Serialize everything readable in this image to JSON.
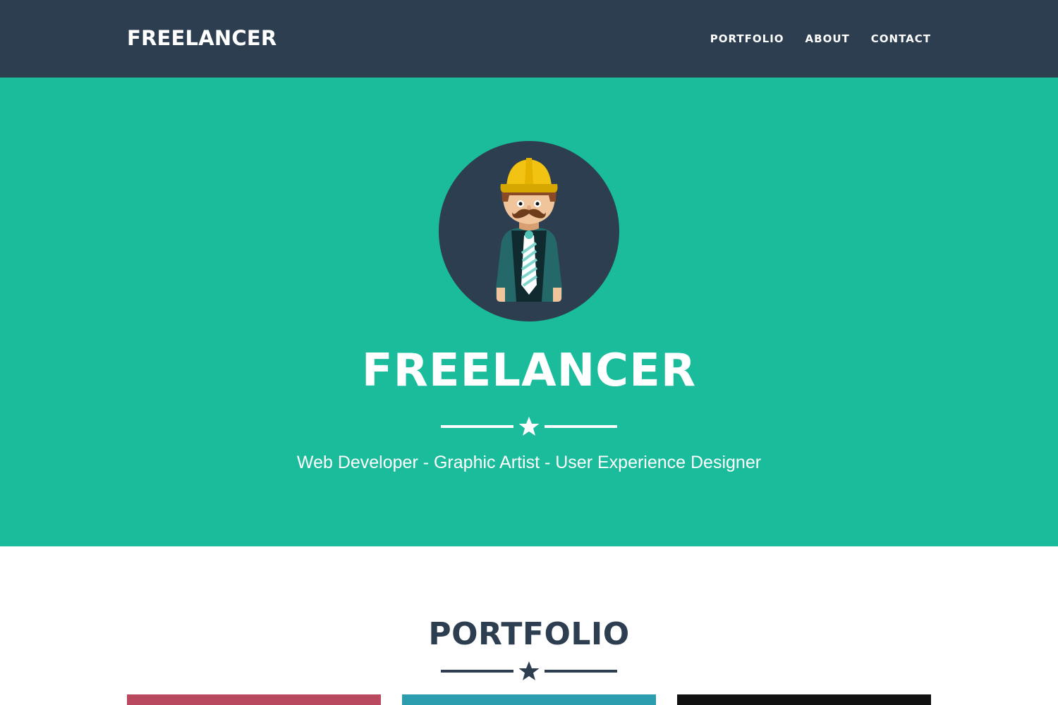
{
  "navbar": {
    "brand": "FREELANCER",
    "links": [
      "PORTFOLIO",
      "ABOUT",
      "CONTACT"
    ]
  },
  "hero": {
    "title": "FREELANCER",
    "subtitle": "Web Developer - Graphic Artist - User Experience Designer"
  },
  "portfolio": {
    "title": "PORTFOLIO",
    "items": [
      {
        "color": "#b9495f"
      },
      {
        "color": "#2b9dae"
      },
      {
        "color": "#111111"
      }
    ]
  },
  "colors": {
    "navbar": "#2c3e50",
    "hero": "#1abc9c",
    "heading_dark": "#2c3e50",
    "white": "#ffffff"
  },
  "icons": {
    "divider": "star-icon",
    "avatar": "avatar-illustration"
  }
}
